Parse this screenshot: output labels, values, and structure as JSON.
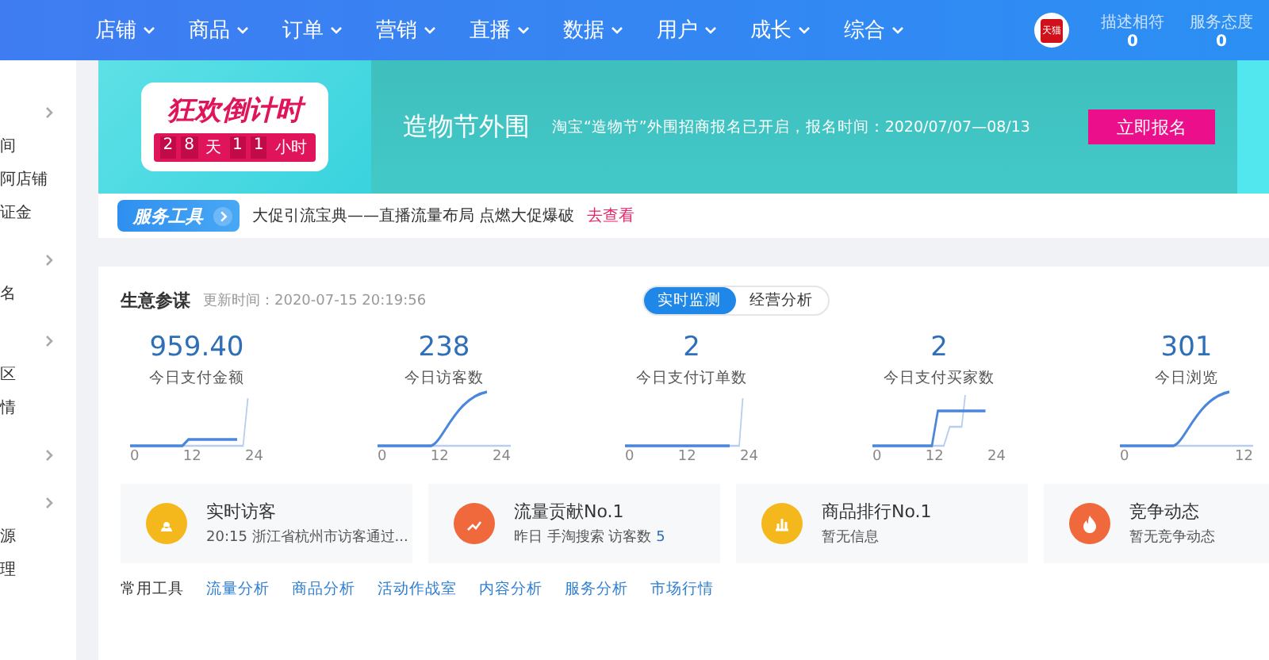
{
  "top_nav": {
    "menu": [
      {
        "label": "店铺"
      },
      {
        "label": "商品"
      },
      {
        "label": "订单"
      },
      {
        "label": "营销"
      },
      {
        "label": "直播"
      },
      {
        "label": "数据"
      },
      {
        "label": "用户"
      },
      {
        "label": "成长"
      },
      {
        "label": "综合"
      }
    ],
    "shop_badge": "天猫",
    "ratings": [
      {
        "label": "描述相符",
        "value": "0"
      },
      {
        "label": "服务态度",
        "value": "0"
      }
    ]
  },
  "sidebar": {
    "items": [
      {
        "kind": "chevron"
      },
      {
        "kind": "label",
        "text": "间"
      },
      {
        "kind": "label",
        "text": "阿店铺"
      },
      {
        "kind": "label",
        "text": "证金"
      },
      {
        "kind": "chevron"
      },
      {
        "kind": "label",
        "text": "名"
      },
      {
        "kind": "chevron"
      },
      {
        "kind": "label",
        "text": "区"
      },
      {
        "kind": "label",
        "text": "情"
      },
      {
        "kind": "chevron"
      },
      {
        "kind": "chevron"
      },
      {
        "kind": "label",
        "text": "源"
      },
      {
        "kind": "label",
        "text": "理"
      }
    ]
  },
  "banner": {
    "countdown": {
      "title": "狂欢倒计时",
      "parts": [
        {
          "kind": "digit",
          "text": "2"
        },
        {
          "kind": "digit",
          "text": "8"
        },
        {
          "kind": "unit",
          "text": "天"
        },
        {
          "kind": "digit",
          "text": "1"
        },
        {
          "kind": "digit",
          "text": "1"
        },
        {
          "kind": "unit",
          "text": "小时"
        }
      ]
    },
    "title": "造物节外围",
    "description": "淘宝“造物节”外围招商报名已开启，报名时间：2020/07/07—08/13",
    "button": "立即报名"
  },
  "service_bar": {
    "badge": "服务工具",
    "text": "大促引流宝典——直播流量布局 点燃大促爆破",
    "link": "去查看"
  },
  "dashboard": {
    "title": "生意参谋",
    "updated": "更新时间：2020-07-15 20:19:56",
    "tabs": [
      {
        "label": "实时监测",
        "selected": true
      },
      {
        "label": "经营分析",
        "selected": false
      }
    ],
    "metrics": [
      {
        "value": "959.40",
        "label": "今日支付金额",
        "axis": [
          "0",
          "12",
          "24"
        ]
      },
      {
        "value": "238",
        "label": "今日访客数",
        "axis": [
          "0",
          "12",
          "24"
        ]
      },
      {
        "value": "2",
        "label": "今日支付订单数",
        "axis": [
          "0",
          "12",
          "24"
        ]
      },
      {
        "value": "2",
        "label": "今日支付买家数",
        "axis": [
          "0",
          "12",
          "24"
        ]
      },
      {
        "value": "301",
        "label": "今日浏览",
        "axis": [
          "0",
          "12"
        ]
      }
    ],
    "info_cards": [
      {
        "kind": "visitor",
        "color": "#f5b81c",
        "title": "实时访客",
        "subtitle": "20:15 浙江省杭州市访客通过..."
      },
      {
        "kind": "traffic",
        "color": "#f0693d",
        "title": "流量贡献No.1",
        "subtitle": "昨日 手淘搜索 访客数",
        "highlight": "5"
      },
      {
        "kind": "ranking",
        "color": "#f5b81c",
        "title": "商品排行No.1",
        "subtitle": "暂无信息"
      },
      {
        "kind": "competition",
        "color": "#f0693d",
        "title": "竞争动态",
        "subtitle": "暂无竞争动态"
      }
    ],
    "tools": {
      "label": "常用工具",
      "links": [
        "流量分析",
        "商品分析",
        "活动作战室",
        "内容分析",
        "服务分析",
        "市场行情"
      ]
    }
  }
}
